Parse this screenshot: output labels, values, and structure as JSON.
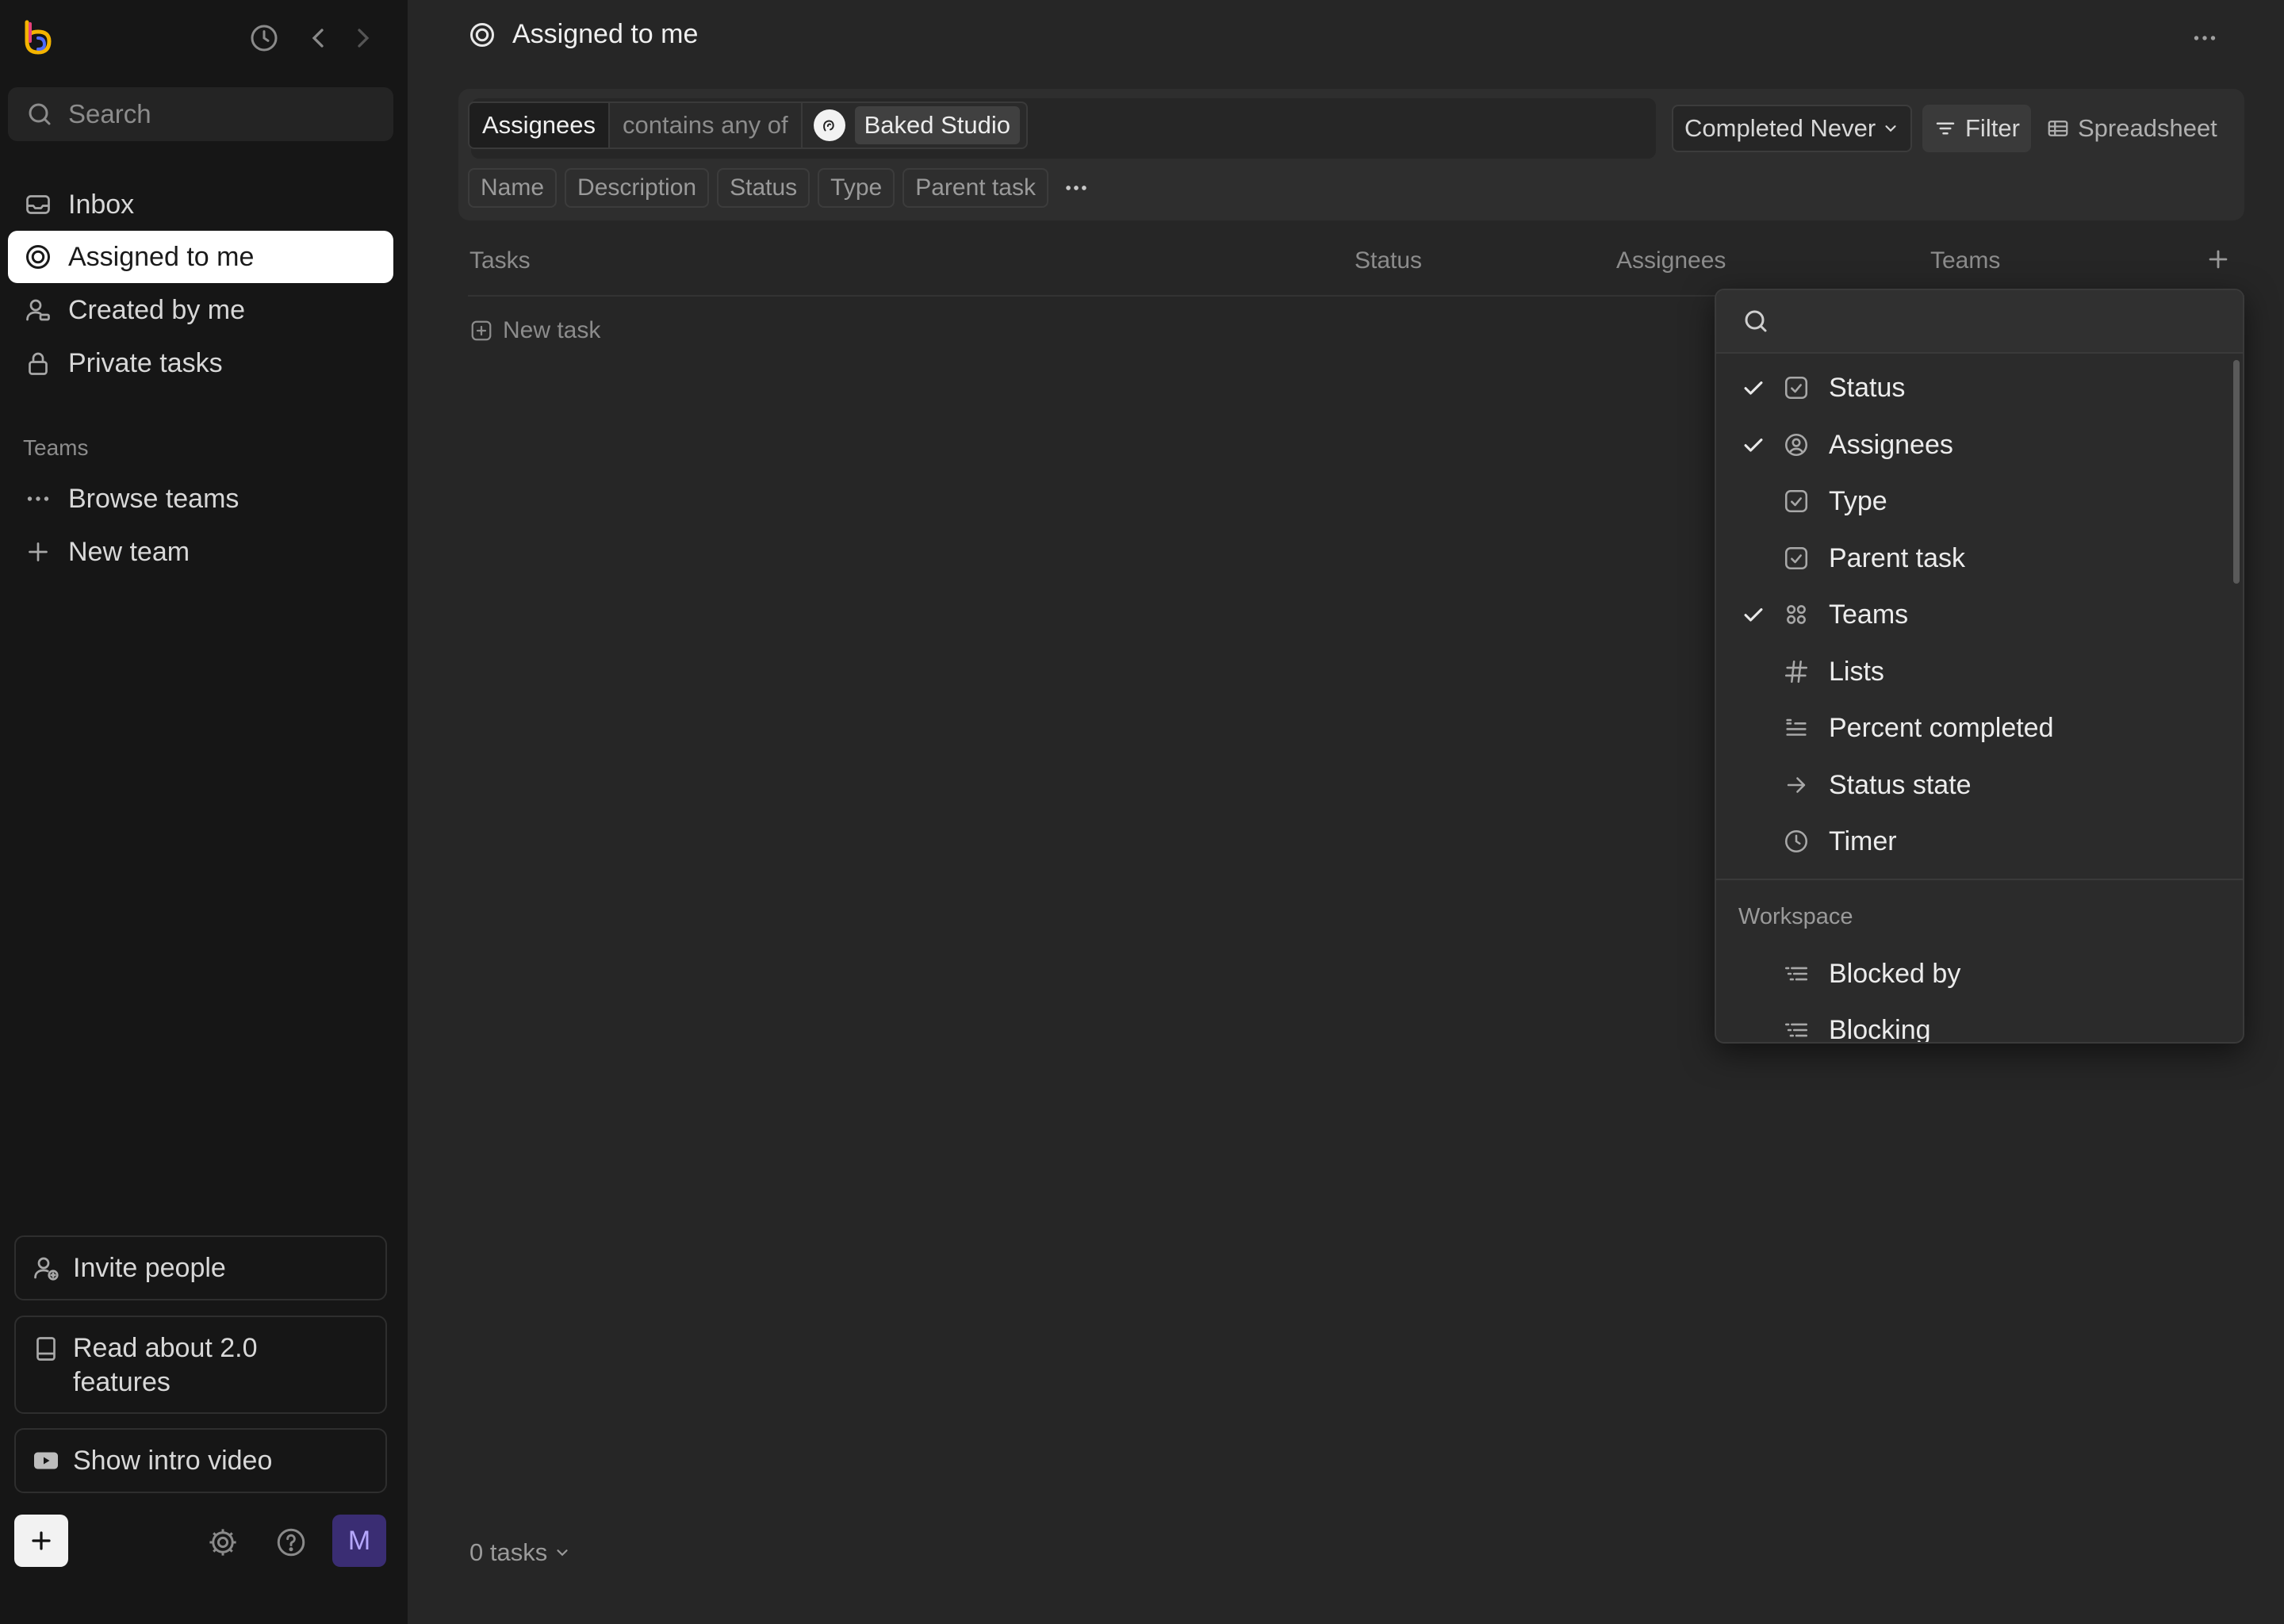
{
  "sidebar": {
    "search_placeholder": "Search",
    "nav": [
      {
        "label": "Inbox",
        "icon": "inbox-icon"
      },
      {
        "label": "Assigned to me",
        "icon": "target-icon",
        "active": true
      },
      {
        "label": "Created by me",
        "icon": "user-icon"
      },
      {
        "label": "Private tasks",
        "icon": "lock-icon"
      }
    ],
    "teams_section": "Teams",
    "team_items": [
      {
        "label": "Browse teams",
        "icon": "dots-icon"
      },
      {
        "label": "New team",
        "icon": "plus-icon"
      }
    ],
    "invite_label": "Invite people",
    "read_label": "Read about 2.0 features",
    "video_label": "Show intro video",
    "avatar_initial": "M"
  },
  "header": {
    "title": "Assigned to me"
  },
  "filter": {
    "field": "Assignees",
    "operator": "contains any of",
    "value": "Baked Studio",
    "completed_label": "Completed Never",
    "filter_label": "Filter",
    "view_label": "Spreadsheet",
    "column_tags": [
      "Name",
      "Description",
      "Status",
      "Type",
      "Parent task"
    ]
  },
  "table": {
    "columns": [
      "Tasks",
      "Status",
      "Assignees",
      "Teams"
    ],
    "new_task_label": "New task",
    "count_label": "0 tasks"
  },
  "dropdown": {
    "search_value": "",
    "items": [
      {
        "label": "Status",
        "checked": true,
        "icon": "checkbox-icon"
      },
      {
        "label": "Assignees",
        "checked": true,
        "icon": "user-circle-icon"
      },
      {
        "label": "Type",
        "checked": false,
        "icon": "checkbox-icon"
      },
      {
        "label": "Parent task",
        "checked": false,
        "icon": "checkbox-icon"
      },
      {
        "label": "Teams",
        "checked": true,
        "icon": "grid-dots-icon"
      },
      {
        "label": "Lists",
        "checked": false,
        "icon": "hash-icon"
      },
      {
        "label": "Percent completed",
        "checked": false,
        "icon": "text-lines-icon"
      },
      {
        "label": "Status state",
        "checked": false,
        "icon": "arrow-right-icon"
      },
      {
        "label": "Timer",
        "checked": false,
        "icon": "clock-icon"
      }
    ],
    "section_label": "Workspace",
    "section_items": [
      {
        "label": "Blocked by",
        "icon": "list-icon"
      },
      {
        "label": "Blocking",
        "icon": "list-icon"
      }
    ]
  },
  "colors": {
    "sidebar_bg": "#161616",
    "main_bg": "#262626",
    "active_nav_bg": "#ffffff",
    "avatar_bg": "#3a2d73"
  }
}
